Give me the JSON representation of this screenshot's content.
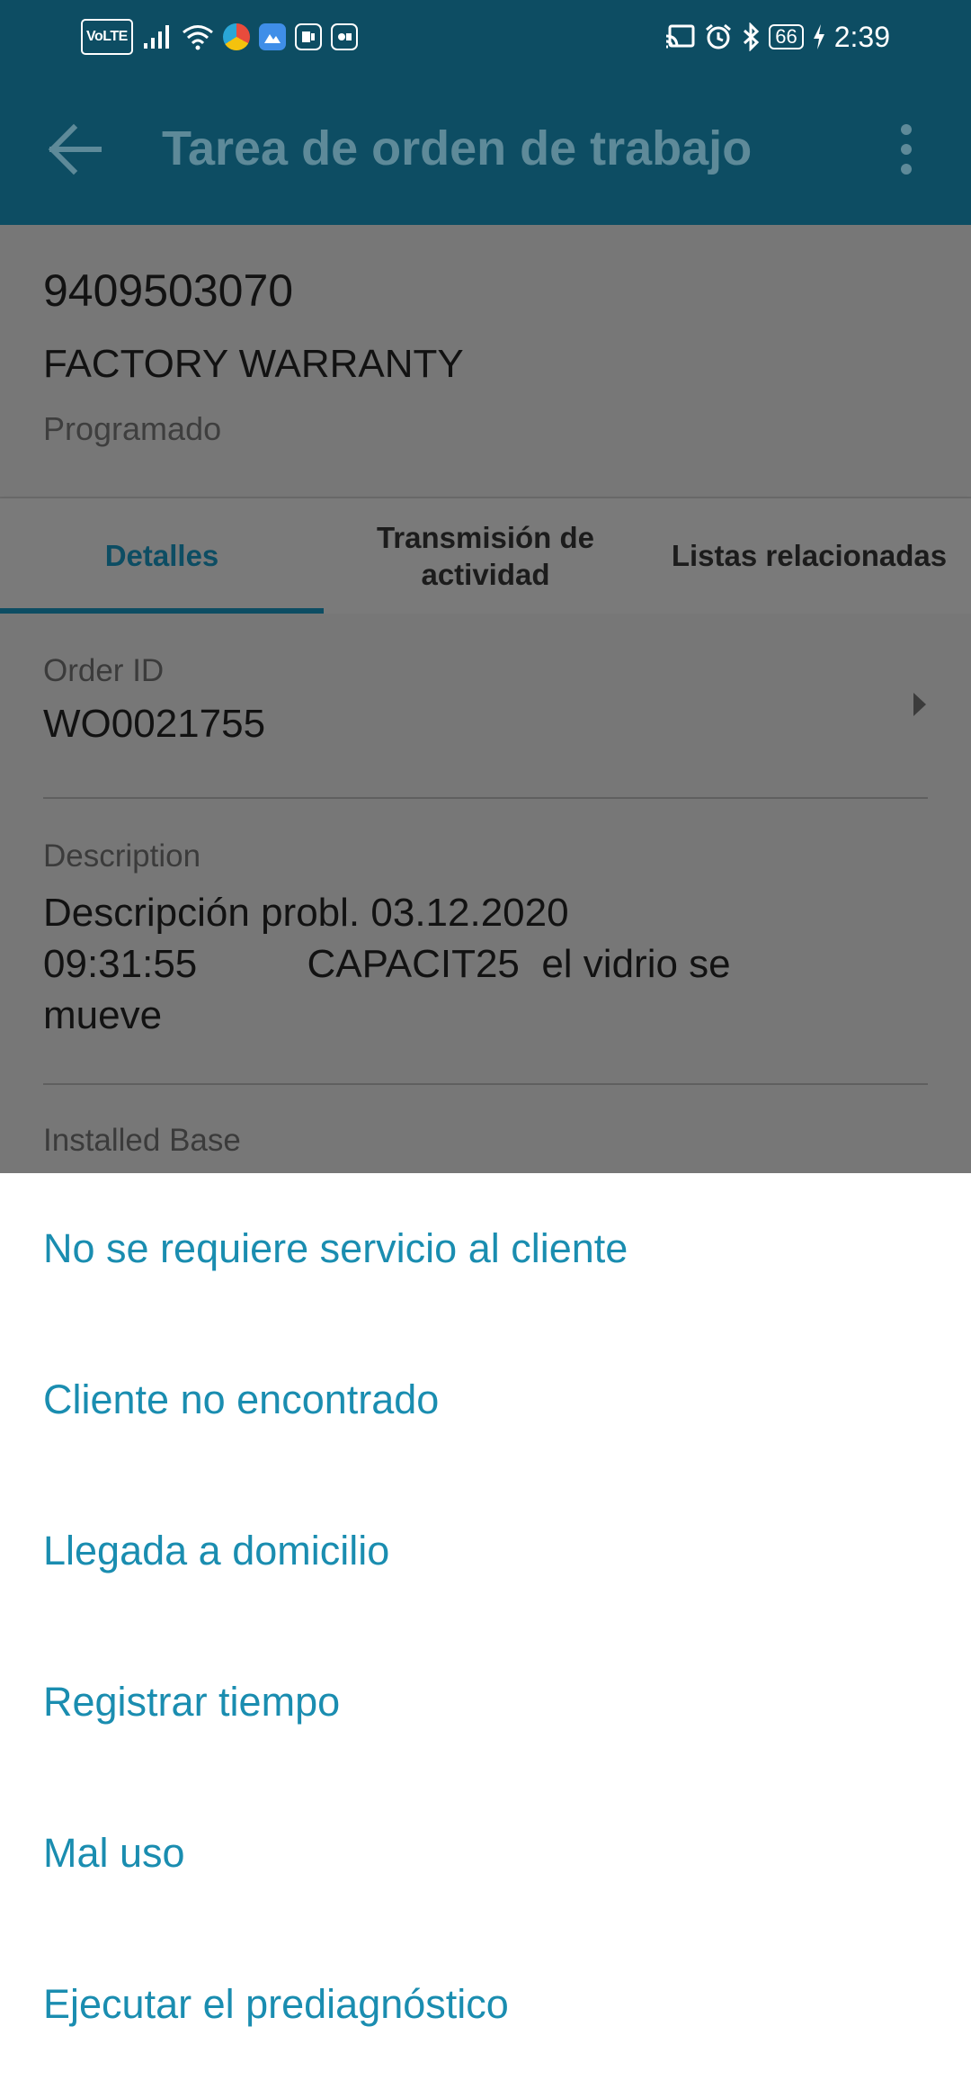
{
  "status_bar": {
    "volte": "VoLTE",
    "time": "2:39",
    "battery": "66",
    "icons": [
      "volte-icon",
      "signal-icon",
      "wifi-icon",
      "browser-app-icon",
      "gallery-app-icon",
      "office-app-icon",
      "outlook-app-icon",
      "cast-icon",
      "alarm-icon",
      "bluetooth-icon",
      "battery-icon",
      "charging-icon"
    ],
    "colors": {
      "background": "#0d4d63"
    }
  },
  "app_bar": {
    "title": "Tarea de orden de trabajo",
    "back_icon": "arrow-left-icon",
    "menu_icon": "more-vert-icon"
  },
  "header": {
    "order_number": "9409503070",
    "order_type": "FACTORY WARRANTY",
    "status": "Programado"
  },
  "tabs": [
    {
      "label": "Detalles",
      "active": true
    },
    {
      "label": "Transmisión de actividad",
      "active": false
    },
    {
      "label": "Listas relacionadas",
      "active": false
    }
  ],
  "details": {
    "order_id": {
      "label": "Order ID",
      "value": "WO0021755"
    },
    "description": {
      "label": "Description",
      "value": "Descripción probl. 03.12.2020\n09:31:55          CAPACIT25  el vidrio se\nmueve"
    },
    "installed_base": {
      "label": "Installed Base"
    }
  },
  "action_sheet": {
    "items": [
      "No se requiere servicio al cliente",
      "Cliente no encontrado",
      "Llegada a domicilio",
      "Registrar tiempo",
      "Mal uso",
      "Ejecutar el prediagnóstico"
    ],
    "accent_color": "#1a8db0"
  }
}
